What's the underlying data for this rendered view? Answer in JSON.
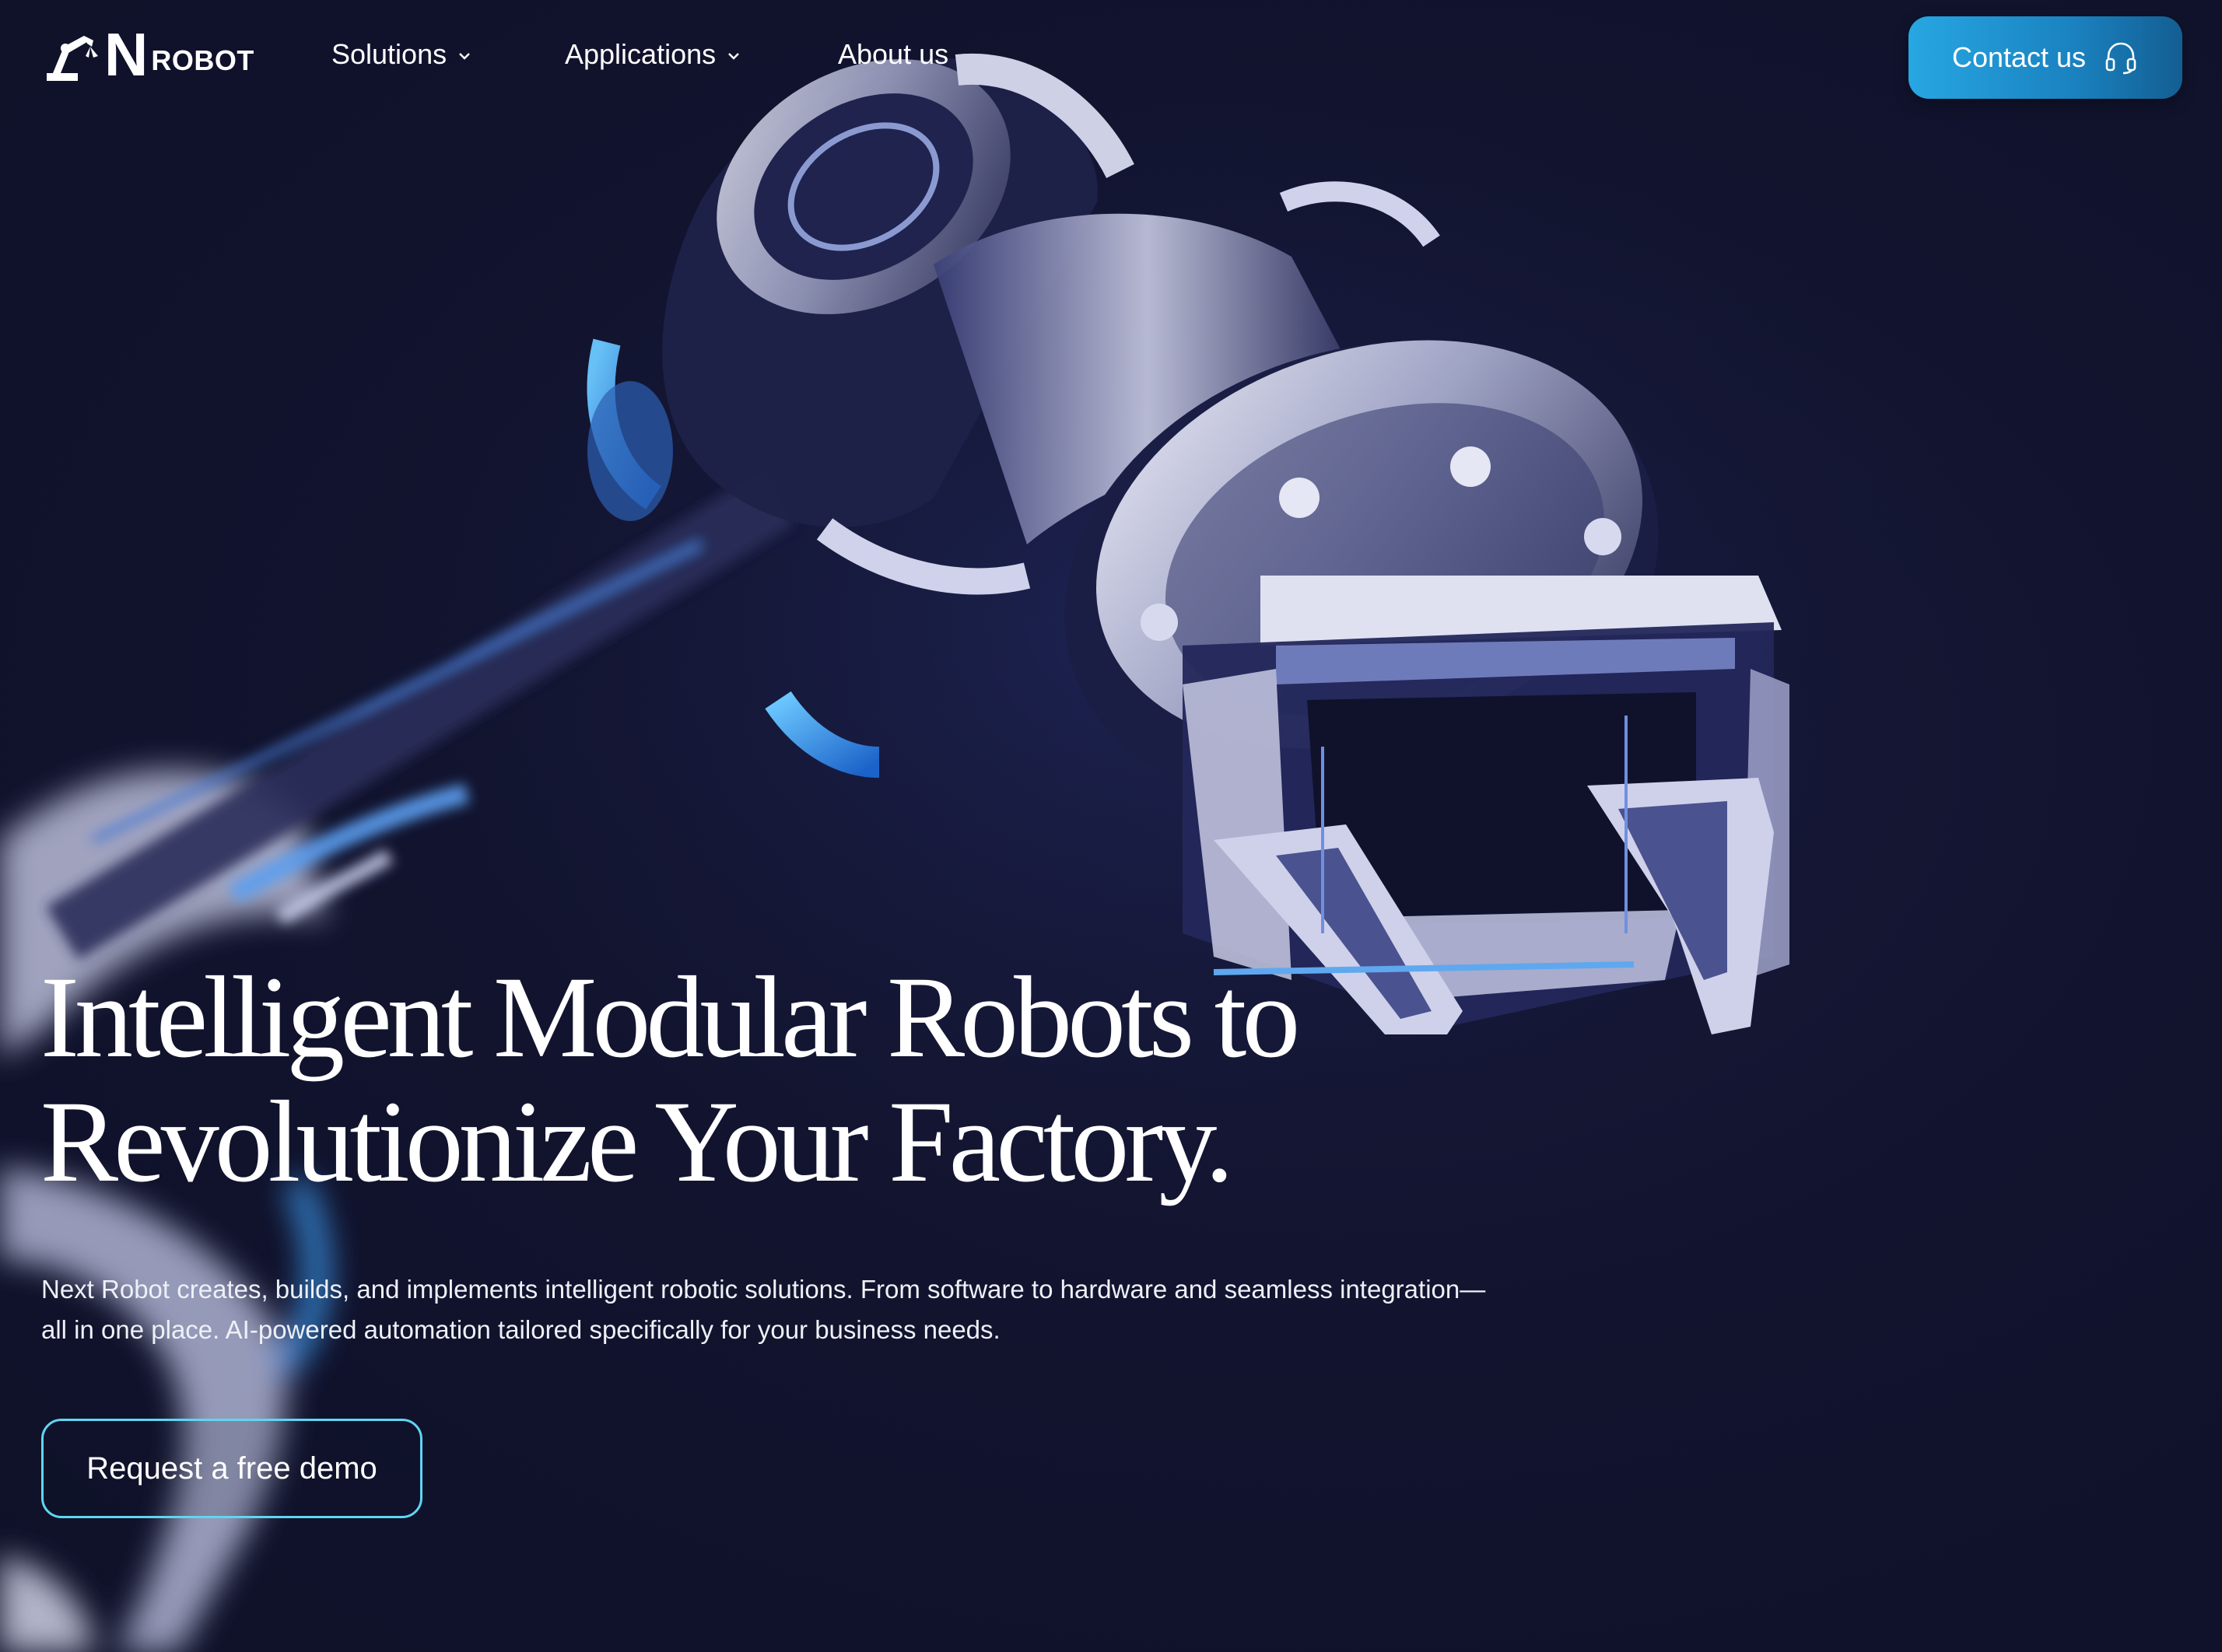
{
  "brand": {
    "logo_letter": "N",
    "logo_word": "ROBOT"
  },
  "nav": {
    "items": [
      {
        "label": "Solutions",
        "has_dropdown": true
      },
      {
        "label": "Applications",
        "has_dropdown": true
      },
      {
        "label": "About us",
        "has_dropdown": false
      }
    ],
    "contact_label": "Contact us",
    "contact_icon": "headset-icon"
  },
  "hero": {
    "title_lines": [
      "Intelligent Modular Robots to",
      "Revolutionize Your Factory."
    ],
    "description_lines": [
      "Next Robot creates, builds, and implements intelligent robotic solutions. From software to hardware and seamless integration—",
      "all in one place. AI-powered automation tailored specifically for your business needs."
    ],
    "cta_label": "Request a free demo",
    "image_subject": "robot-arm-gripper"
  },
  "colors": {
    "background": "#11142f",
    "accent_gradient_start": "#27a7e3",
    "accent_gradient_end": "#135e92",
    "outline_accent": "#5fd6f2",
    "text": "#ffffff"
  }
}
